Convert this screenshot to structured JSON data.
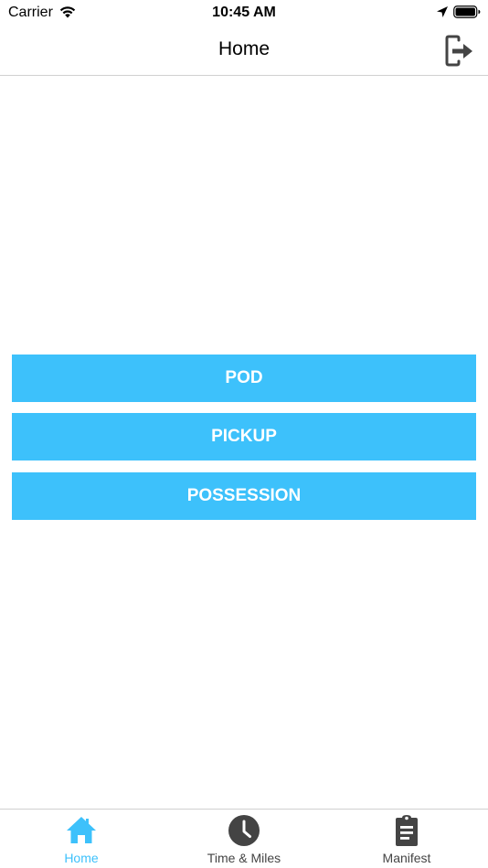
{
  "status_bar": {
    "carrier": "Carrier",
    "time": "10:45 AM"
  },
  "nav": {
    "title": "Home",
    "logout_icon": "logout-icon"
  },
  "actions": {
    "pod_label": "POD",
    "pickup_label": "PICKUP",
    "possession_label": "POSSESSION"
  },
  "tabs": [
    {
      "label": "Home",
      "icon": "home-icon",
      "active": true
    },
    {
      "label": "Time & Miles",
      "icon": "clock-icon",
      "active": false
    },
    {
      "label": "Manifest",
      "icon": "clipboard-icon",
      "active": false
    }
  ],
  "colors": {
    "accent": "#3dc1fb",
    "inactive_icon": "#444444",
    "divider": "#d0d0d0"
  }
}
